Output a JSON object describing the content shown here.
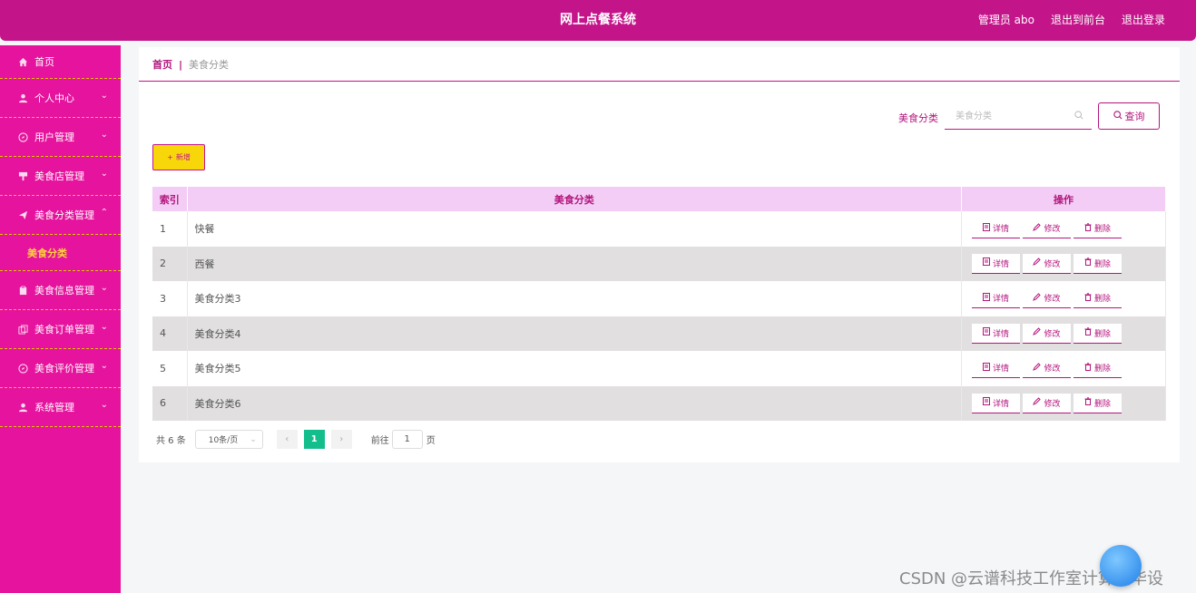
{
  "app": {
    "title": "网上点餐系统",
    "user_label": "管理员 abo",
    "back_front": "退出到前台",
    "logout": "退出登录"
  },
  "sidebar": {
    "items": [
      {
        "label": "首页",
        "icon": "home-icon"
      },
      {
        "label": "个人中心",
        "icon": "user-icon"
      },
      {
        "label": "用户管理",
        "icon": "compass-icon"
      },
      {
        "label": "美食店管理",
        "icon": "shop-icon"
      },
      {
        "label": "美食分类管理",
        "icon": "send-icon"
      },
      {
        "label": "美食分类",
        "icon": ""
      },
      {
        "label": "美食信息管理",
        "icon": "clipboard-icon"
      },
      {
        "label": "美食订单管理",
        "icon": "copy-icon"
      },
      {
        "label": "美食评价管理",
        "icon": "compass-icon"
      },
      {
        "label": "系统管理",
        "icon": "user-icon"
      }
    ]
  },
  "breadcrumb": {
    "home": "首页",
    "sep": "|",
    "current": "美食分类"
  },
  "search": {
    "label": "美食分类",
    "placeholder": "美食分类",
    "button": "查询"
  },
  "toolbar": {
    "add_label": "新增"
  },
  "table": {
    "headers": [
      "索引",
      "美食分类",
      "操作"
    ],
    "rows": [
      {
        "index": "1",
        "name": "快餐"
      },
      {
        "index": "2",
        "name": "西餐"
      },
      {
        "index": "3",
        "name": "美食分类3"
      },
      {
        "index": "4",
        "name": "美食分类4"
      },
      {
        "index": "5",
        "name": "美食分类5"
      },
      {
        "index": "6",
        "name": "美食分类6"
      }
    ],
    "ops": {
      "detail": "详情",
      "edit": "修改",
      "delete": "删除"
    }
  },
  "pager": {
    "total": "共 6 条",
    "page_size": "10条/页",
    "current_page": "1",
    "goto_label": "前往",
    "goto_value": "1",
    "page_suffix": "页"
  },
  "watermark": "CSDN @云谱科技工作室计算机毕设",
  "colors": {
    "topbar": "#c4148a",
    "sidebar": "#e5139d",
    "accent": "#b3167d",
    "add_button": "#f8d70a",
    "active_page": "#13be8c"
  }
}
